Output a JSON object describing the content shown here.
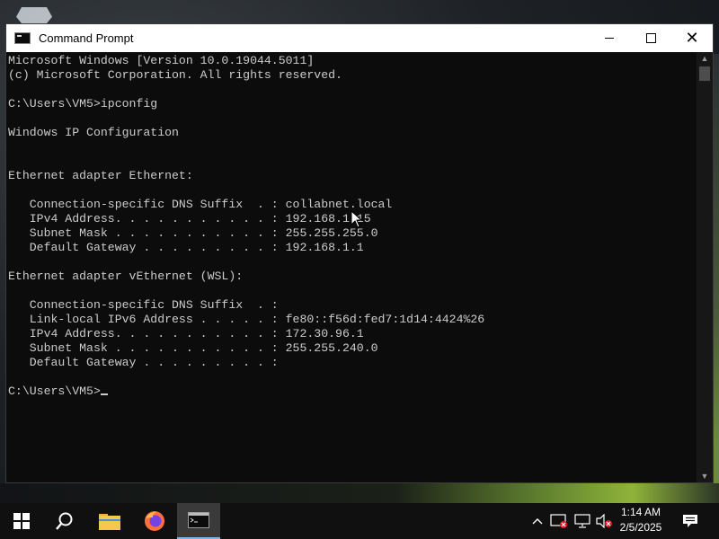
{
  "window": {
    "title": "Command Prompt"
  },
  "console": {
    "lines": [
      "Microsoft Windows [Version 10.0.19044.5011]",
      "(c) Microsoft Corporation. All rights reserved.",
      "",
      "C:\\Users\\VM5>ipconfig",
      "",
      "Windows IP Configuration",
      "",
      "",
      "Ethernet adapter Ethernet:",
      "",
      "   Connection-specific DNS Suffix  . : collabnet.local",
      "   IPv4 Address. . . . . . . . . . . : 192.168.1.15",
      "   Subnet Mask . . . . . . . . . . . : 255.255.255.0",
      "   Default Gateway . . . . . . . . . : 192.168.1.1",
      "",
      "Ethernet adapter vEthernet (WSL):",
      "",
      "   Connection-specific DNS Suffix  . :",
      "   Link-local IPv6 Address . . . . . : fe80::f56d:fed7:1d14:4424%26",
      "   IPv4 Address. . . . . . . . . . . : 172.30.96.1",
      "   Subnet Mask . . . . . . . . . . . : 255.255.240.0",
      "   Default Gateway . . . . . . . . . :",
      ""
    ],
    "prompt": "C:\\Users\\VM5>"
  },
  "taskbar": {
    "pinned": [
      "start-icon",
      "search-icon",
      "file-explorer-icon",
      "firefox-icon",
      "command-prompt-icon"
    ],
    "tray": [
      "chevron-up-icon",
      "security-icon",
      "network-icon",
      "volume-muted-icon",
      "notification-icon"
    ],
    "time": "1:14 AM",
    "date": "2/5/2025"
  },
  "colors": {
    "console_bg": "#0c0c0c",
    "console_text": "#cccccc",
    "taskbar_bg": "#101010",
    "firefox_orange": "#ff7139"
  }
}
